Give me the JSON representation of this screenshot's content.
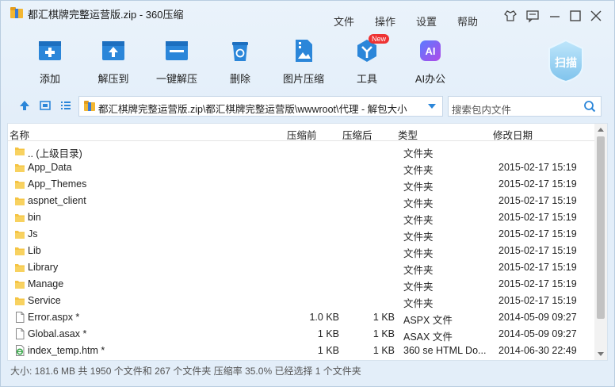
{
  "window": {
    "title": "都汇棋牌完整运营版.zip - 360压缩"
  },
  "menu": {
    "file": "文件",
    "ops": "操作",
    "settings": "设置",
    "help": "帮助"
  },
  "toolbar": {
    "add": "添加",
    "extract_to": "解压到",
    "one_click": "一键解压",
    "delete": "删除",
    "image_compress": "图片压缩",
    "tools": "工具",
    "ai": "AI办公",
    "new_badge": "New",
    "scan": "扫描"
  },
  "nav": {
    "path": "都汇棋牌完整运营版.zip\\都汇棋牌完整运营版\\wwwroot\\代理 - 解包大小",
    "search_placeholder": "搜索包内文件"
  },
  "columns": {
    "name": "名称",
    "size": "压缩前",
    "packed": "压缩后",
    "type": "类型",
    "modified": "修改日期"
  },
  "files": [
    {
      "icon": "folder-icon",
      "name": ".. (上级目录)",
      "size": "",
      "packed": "",
      "type": "文件夹",
      "modified": ""
    },
    {
      "icon": "folder-icon",
      "name": "App_Data",
      "size": "",
      "packed": "",
      "type": "文件夹",
      "modified": "2015-02-17 15:19"
    },
    {
      "icon": "folder-icon",
      "name": "App_Themes",
      "size": "",
      "packed": "",
      "type": "文件夹",
      "modified": "2015-02-17 15:19"
    },
    {
      "icon": "folder-icon",
      "name": "aspnet_client",
      "size": "",
      "packed": "",
      "type": "文件夹",
      "modified": "2015-02-17 15:19"
    },
    {
      "icon": "folder-icon",
      "name": "bin",
      "size": "",
      "packed": "",
      "type": "文件夹",
      "modified": "2015-02-17 15:19"
    },
    {
      "icon": "folder-icon",
      "name": "Js",
      "size": "",
      "packed": "",
      "type": "文件夹",
      "modified": "2015-02-17 15:19"
    },
    {
      "icon": "folder-icon",
      "name": "Lib",
      "size": "",
      "packed": "",
      "type": "文件夹",
      "modified": "2015-02-17 15:19"
    },
    {
      "icon": "folder-icon",
      "name": "Library",
      "size": "",
      "packed": "",
      "type": "文件夹",
      "modified": "2015-02-17 15:19"
    },
    {
      "icon": "folder-icon",
      "name": "Manage",
      "size": "",
      "packed": "",
      "type": "文件夹",
      "modified": "2015-02-17 15:19"
    },
    {
      "icon": "folder-icon",
      "name": "Service",
      "size": "",
      "packed": "",
      "type": "文件夹",
      "modified": "2015-02-17 15:19"
    },
    {
      "icon": "file-icon",
      "name": "Error.aspx *",
      "size": "1.0 KB",
      "packed": "1 KB",
      "type": "ASPX 文件",
      "modified": "2014-05-09 09:27"
    },
    {
      "icon": "file-icon",
      "name": "Global.asax *",
      "size": "1 KB",
      "packed": "1 KB",
      "type": "ASAX 文件",
      "modified": "2014-05-09 09:27"
    },
    {
      "icon": "html-file-icon",
      "name": "index_temp.htm *",
      "size": "1 KB",
      "packed": "1 KB",
      "type": "360 se HTML Do...",
      "modified": "2014-06-30 22:49"
    }
  ],
  "status": "大小: 181.6 MB 共 1950 个文件和 267 个文件夹 压缩率 35.0% 已经选择 1 个文件夹"
}
